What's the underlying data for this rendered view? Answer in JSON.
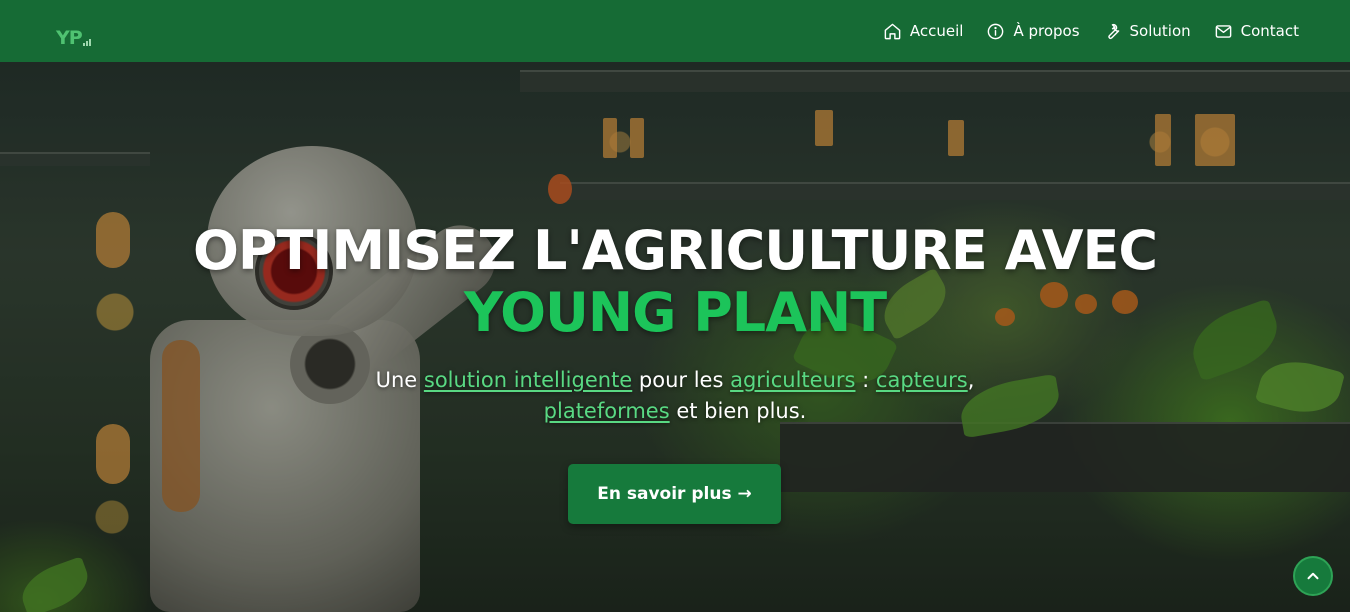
{
  "brand": {
    "logo_text": "YP",
    "logo_color": "#4fc271"
  },
  "nav": {
    "items": [
      {
        "label": "Accueil",
        "icon": "home-icon"
      },
      {
        "label": "À propos",
        "icon": "info-icon"
      },
      {
        "label": "Solution",
        "icon": "wrench-icon"
      },
      {
        "label": "Contact",
        "icon": "mail-icon"
      }
    ],
    "background_color": "#166b35"
  },
  "hero": {
    "title_line1": "OPTIMISEZ L'AGRICULTURE AVEC",
    "title_line2": "YOUNG PLANT",
    "subtitle": {
      "part1": "Une ",
      "link1": "solution intelligente",
      "part2": " pour les ",
      "link2": "agriculteurs",
      "part3": " : ",
      "link3": "capteurs",
      "part4": ", ",
      "link4": "plateformes",
      "part5": " et bien plus."
    },
    "cta_label": "En savoir plus →",
    "accent_color": "#1cc45a",
    "button_color": "#167a3c"
  },
  "scroll_top": {
    "icon": "chevron-up-icon"
  }
}
